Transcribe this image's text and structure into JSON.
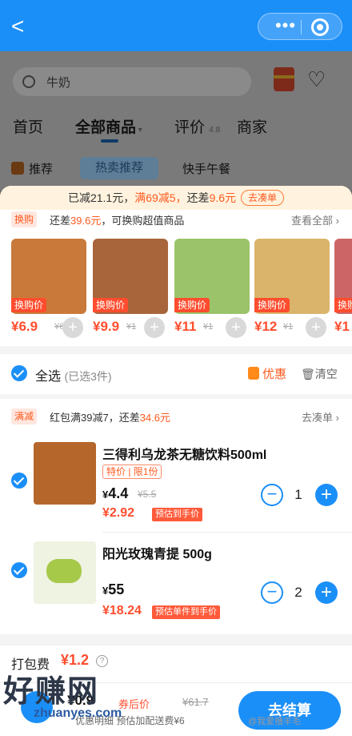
{
  "header": {
    "back_label": "<",
    "more_label": "•••"
  },
  "search": {
    "query": "牛奶"
  },
  "tabs": [
    {
      "label": "首页"
    },
    {
      "label": "全部商品"
    },
    {
      "label": "评价",
      "score": "4.8"
    },
    {
      "label": "商家"
    }
  ],
  "subtabs": {
    "recommend": "推荐",
    "hot": "热卖推荐",
    "lunch": "快手午餐"
  },
  "promo_bar": {
    "done": "已减21.1元，",
    "rule": "满69减5，",
    "gap_prefix": "还差",
    "gap": "9.6元",
    "button": "去凑单"
  },
  "swap": {
    "tag": "换购",
    "text_prefix": "还差",
    "gap": "39.6元",
    "text_suffix": "，可换购超值商品",
    "view_all": "查看全部 ›",
    "products": [
      {
        "label": "换购价",
        "price": "¥6.9",
        "old": "¥6",
        "color": "#c9793a"
      },
      {
        "label": "换购价",
        "price": "¥9.9",
        "old": "¥1",
        "color": "#a8653c"
      },
      {
        "label": "换购价",
        "price": "¥11",
        "old": "¥1",
        "color": "#9bc36a"
      },
      {
        "label": "换购价",
        "price": "¥12",
        "old": "¥1",
        "color": "#d9b46a"
      },
      {
        "label": "换购",
        "price": "¥1",
        "old": "",
        "color": "#c66"
      }
    ]
  },
  "select_all": {
    "label": "全选",
    "count": "(已选3件)",
    "discount": "优惠",
    "clear": "清空"
  },
  "manjian": {
    "tag": "满减",
    "text_prefix": "红包满39减7，还差",
    "gap": "34.6元",
    "link": "去凑单 ›"
  },
  "items": [
    {
      "name": "三得利乌龙茶无糖饮料500ml",
      "tags": "特价 | 限1份",
      "price": "4.4",
      "was": "¥5.5",
      "est": "¥2.92",
      "est_tag": "预估到手价",
      "qty": "1",
      "color": "#b5662a"
    },
    {
      "name": "阳光玫瑰青提 500g",
      "tags": "",
      "price": "55",
      "was": "",
      "est": "¥18.24",
      "est_tag": "预估单件到手价",
      "qty": "2",
      "color": "#a6c94a"
    }
  ],
  "packing": {
    "label": "打包费",
    "value": "¥1.2",
    "help": "?"
  },
  "footer": {
    "price": "¥0.9",
    "after_label": "券后价",
    "was": "¥61.7",
    "sub": "优惠明细  预估加配送费¥6",
    "checkout": "去结算"
  },
  "watermark": {
    "big": "好赚网",
    "url": "zhuanyes.com",
    "weibo": "@我爱撸羊毛"
  },
  "colors": {
    "primary": "#1b8ff8",
    "accent": "#ff4d2e"
  }
}
